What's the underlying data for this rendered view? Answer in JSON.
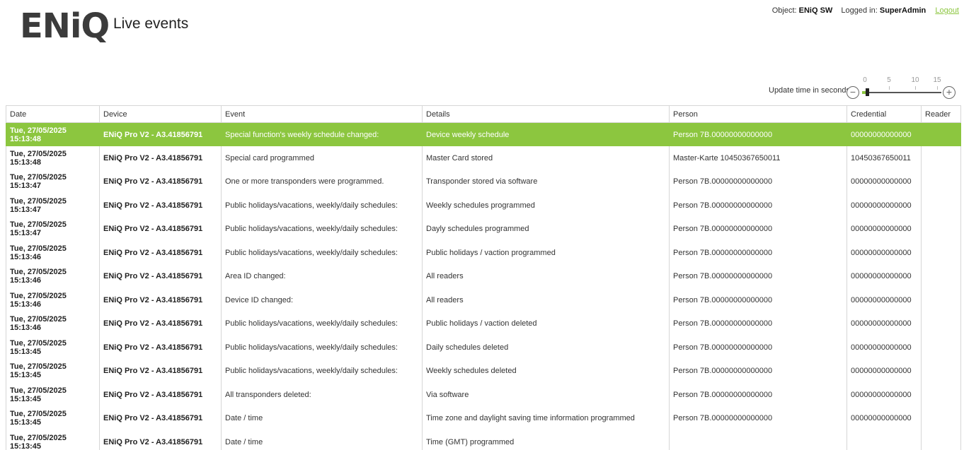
{
  "header": {
    "logo_text": "ENiQ",
    "title": "Live events"
  },
  "userbar": {
    "object_label": "Object:",
    "object_value": "ENiQ SW",
    "logged_label": "Logged in:",
    "logged_value": "SuperAdmin",
    "logout": "Logout"
  },
  "update_time": {
    "label": "Update time in seconds:",
    "ticks": [
      "0",
      "5",
      "10",
      "15"
    ],
    "value_seconds": 1,
    "minus_symbol": "−",
    "plus_symbol": "+"
  },
  "colors": {
    "accent": "#8cc63f"
  },
  "table": {
    "columns": [
      "Date",
      "Device",
      "Event",
      "Details",
      "Person",
      "Credential",
      "Reader"
    ],
    "selected_row": 0,
    "rows": [
      {
        "date_day": "Tue, 27/05/2025",
        "date_time": "15:13:48",
        "device": "ENiQ Pro V2 - A3.41856791",
        "event": "Special function's weekly schedule changed:",
        "details": "Device weekly schedule",
        "person": "Person 7B.00000000000000",
        "credential": "00000000000000",
        "reader": ""
      },
      {
        "date_day": "Tue, 27/05/2025",
        "date_time": "15:13:48",
        "device": "ENiQ Pro V2 - A3.41856791",
        "event": "Special card programmed",
        "details": "Master Card stored",
        "person": "Master-Karte 10450367650011",
        "credential": "10450367650011",
        "reader": ""
      },
      {
        "date_day": "Tue, 27/05/2025",
        "date_time": "15:13:47",
        "device": "ENiQ Pro V2 - A3.41856791",
        "event": "One or more transponders were programmed.",
        "details": "Transponder stored via software",
        "person": "Person 7B.00000000000000",
        "credential": "00000000000000",
        "reader": ""
      },
      {
        "date_day": "Tue, 27/05/2025",
        "date_time": "15:13:47",
        "device": "ENiQ Pro V2 - A3.41856791",
        "event": "Public holidays/vacations, weekly/daily schedules:",
        "details": "Weekly schedules programmed",
        "person": "Person 7B.00000000000000",
        "credential": "00000000000000",
        "reader": ""
      },
      {
        "date_day": "Tue, 27/05/2025",
        "date_time": "15:13:47",
        "device": "ENiQ Pro V2 - A3.41856791",
        "event": "Public holidays/vacations, weekly/daily schedules:",
        "details": "Dayly schedules programmed",
        "person": "Person 7B.00000000000000",
        "credential": "00000000000000",
        "reader": ""
      },
      {
        "date_day": "Tue, 27/05/2025",
        "date_time": "15:13:46",
        "device": "ENiQ Pro V2 - A3.41856791",
        "event": "Public holidays/vacations, weekly/daily schedules:",
        "details": "Public holidays / vaction programmed",
        "person": "Person 7B.00000000000000",
        "credential": "00000000000000",
        "reader": ""
      },
      {
        "date_day": "Tue, 27/05/2025",
        "date_time": "15:13:46",
        "device": "ENiQ Pro V2 - A3.41856791",
        "event": "Area ID changed:",
        "details": "All readers",
        "person": "Person 7B.00000000000000",
        "credential": "00000000000000",
        "reader": ""
      },
      {
        "date_day": "Tue, 27/05/2025",
        "date_time": "15:13:46",
        "device": "ENiQ Pro V2 - A3.41856791",
        "event": "Device ID changed:",
        "details": "All readers",
        "person": "Person 7B.00000000000000",
        "credential": "00000000000000",
        "reader": ""
      },
      {
        "date_day": "Tue, 27/05/2025",
        "date_time": "15:13:46",
        "device": "ENiQ Pro V2 - A3.41856791",
        "event": "Public holidays/vacations, weekly/daily schedules:",
        "details": "Public holidays / vaction deleted",
        "person": "Person 7B.00000000000000",
        "credential": "00000000000000",
        "reader": ""
      },
      {
        "date_day": "Tue, 27/05/2025",
        "date_time": "15:13:45",
        "device": "ENiQ Pro V2 - A3.41856791",
        "event": "Public holidays/vacations, weekly/daily schedules:",
        "details": "Daily schedules deleted",
        "person": "Person 7B.00000000000000",
        "credential": "00000000000000",
        "reader": ""
      },
      {
        "date_day": "Tue, 27/05/2025",
        "date_time": "15:13:45",
        "device": "ENiQ Pro V2 - A3.41856791",
        "event": "Public holidays/vacations, weekly/daily schedules:",
        "details": "Weekly schedules deleted",
        "person": "Person 7B.00000000000000",
        "credential": "00000000000000",
        "reader": ""
      },
      {
        "date_day": "Tue, 27/05/2025",
        "date_time": "15:13:45",
        "device": "ENiQ Pro V2 - A3.41856791",
        "event": "All transponders deleted:",
        "details": "Via software",
        "person": "Person 7B.00000000000000",
        "credential": "00000000000000",
        "reader": ""
      },
      {
        "date_day": "Tue, 27/05/2025",
        "date_time": "15:13:45",
        "device": "ENiQ Pro V2 - A3.41856791",
        "event": "Date / time",
        "details": "Time zone and daylight saving time information programmed",
        "person": "Person 7B.00000000000000",
        "credential": "00000000000000",
        "reader": ""
      },
      {
        "date_day": "Tue, 27/05/2025",
        "date_time": "15:13:45",
        "device": "ENiQ Pro V2 - A3.41856791",
        "event": "Date / time",
        "details": "Time (GMT) programmed",
        "person": "",
        "credential": "",
        "reader": ""
      }
    ]
  }
}
